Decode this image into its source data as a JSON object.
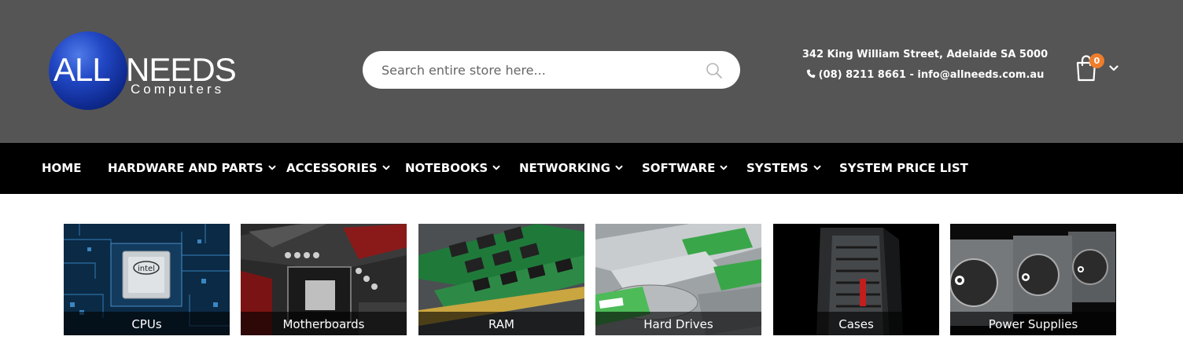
{
  "logo": {
    "word1": "ALL",
    "word2": "NEEDS",
    "subtitle": "Computers"
  },
  "search": {
    "placeholder": "Search entire store here...",
    "value": ""
  },
  "contact": {
    "address": "342 King William Street, Adelaide SA 5000",
    "phone_email": "(08) 8211 8661 - info@allneeds.com.au"
  },
  "cart": {
    "count": "0"
  },
  "nav": {
    "items": [
      {
        "label": "HOME"
      },
      {
        "label": "HARDWARE AND PARTS"
      },
      {
        "label": "ACCESSORIES"
      },
      {
        "label": "NOTEBOOKS"
      },
      {
        "label": "NETWORKING"
      },
      {
        "label": "SOFTWARE"
      },
      {
        "label": "SYSTEMS"
      },
      {
        "label": "SYSTEM PRICE LIST"
      }
    ]
  },
  "categories": [
    {
      "label": "CPUs"
    },
    {
      "label": "Motherboards"
    },
    {
      "label": "RAM"
    },
    {
      "label": "Hard Drives"
    },
    {
      "label": "Cases"
    },
    {
      "label": "Power Supplies"
    }
  ],
  "colors": {
    "header_bg": "#555555",
    "nav_bg": "#000000",
    "badge": "#ef7d2a"
  },
  "icons": [
    "search-icon",
    "phone-icon",
    "shopping-bag-icon",
    "chevron-down-icon"
  ]
}
